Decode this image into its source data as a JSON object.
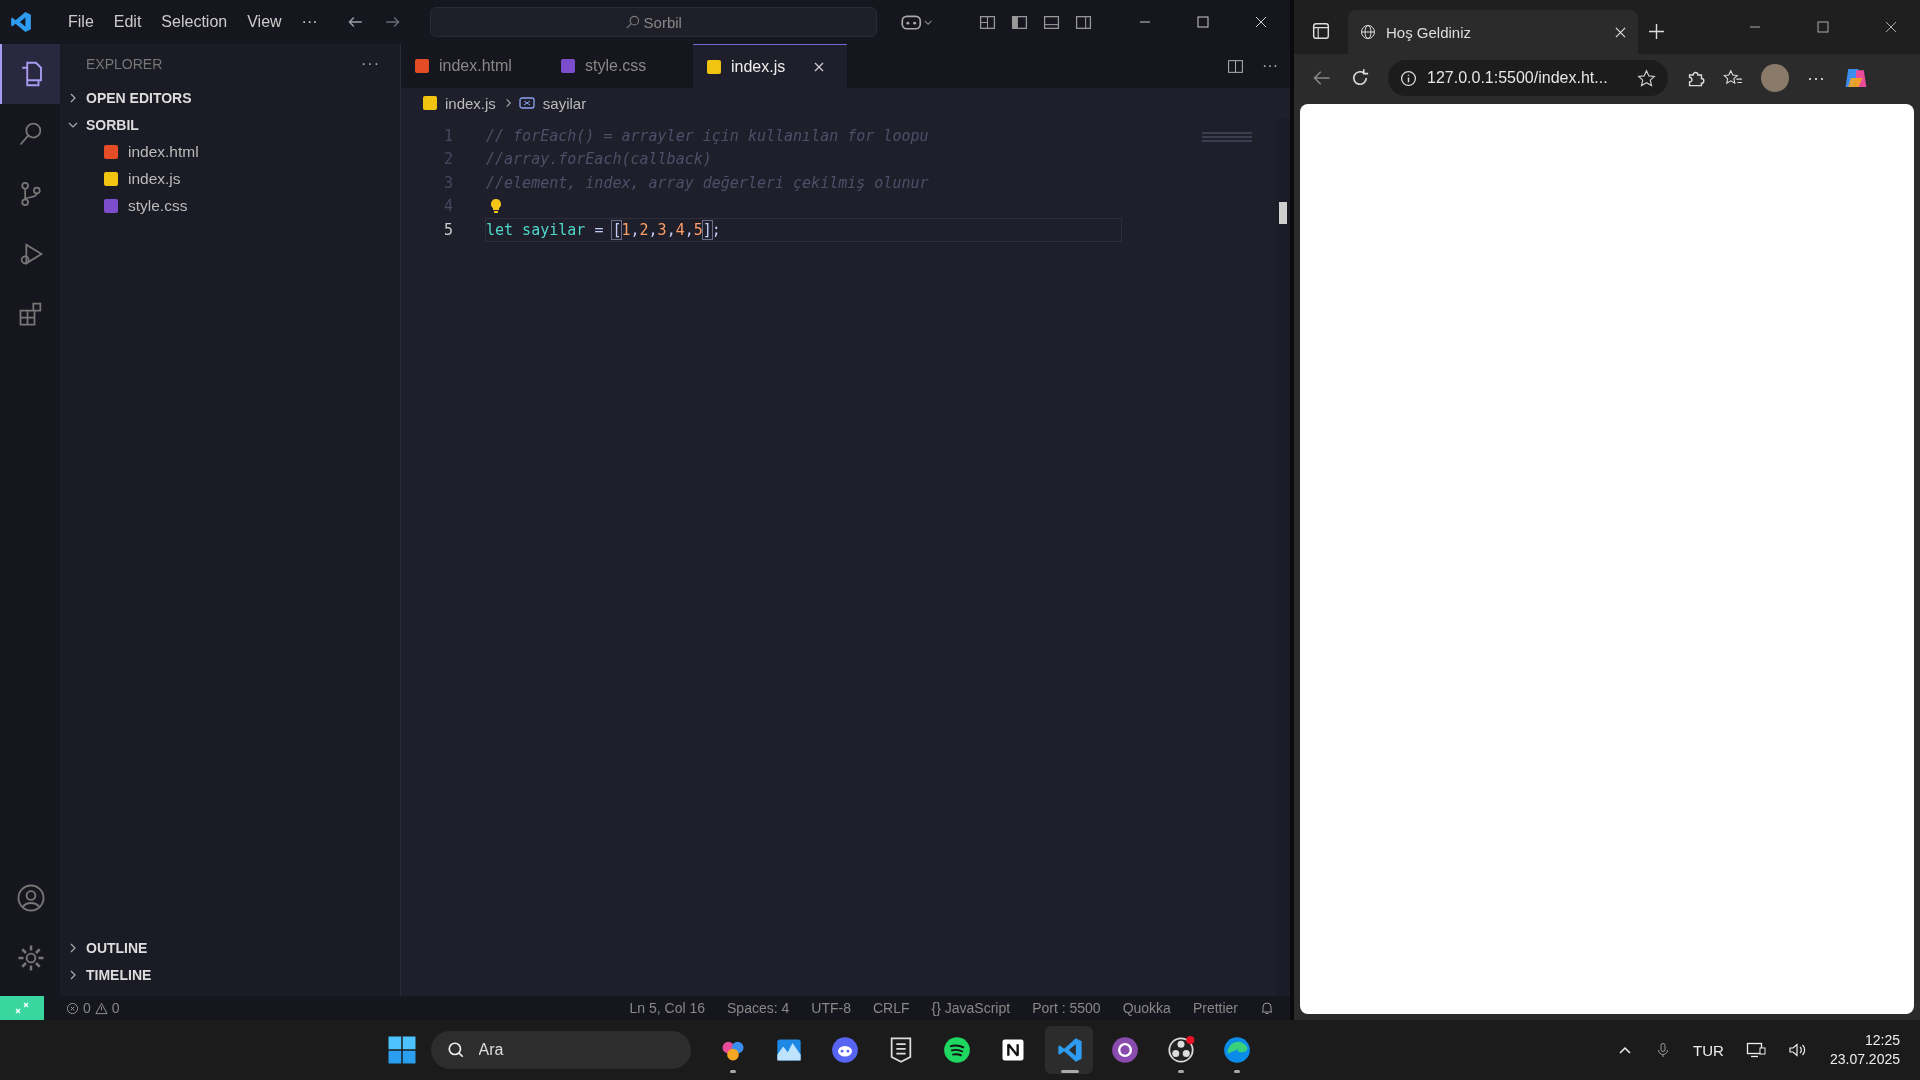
{
  "vscode": {
    "menu": [
      "File",
      "Edit",
      "Selection",
      "View",
      "···"
    ],
    "search": {
      "value": "Sorbil"
    },
    "explorer": {
      "title": "EXPLORER",
      "more": "···",
      "sections": [
        {
          "label": "OPEN EDITORS",
          "expanded": false
        },
        {
          "label": "SORBIL",
          "expanded": true,
          "files": [
            {
              "name": "index.html",
              "kind": "html"
            },
            {
              "name": "index.js",
              "kind": "js"
            },
            {
              "name": "style.css",
              "kind": "css"
            }
          ]
        }
      ],
      "bottom_sections": [
        {
          "label": "OUTLINE",
          "expanded": false
        },
        {
          "label": "TIMELINE",
          "expanded": false
        }
      ]
    },
    "tabs": [
      {
        "label": "index.html",
        "kind": "html",
        "selected": false
      },
      {
        "label": "style.css",
        "kind": "css",
        "selected": false
      },
      {
        "label": "index.js",
        "kind": "js",
        "selected": true
      }
    ],
    "breadcrumb": {
      "file": "index.js",
      "symbol": "sayilar"
    },
    "lines": [
      {
        "number": "1",
        "current": false,
        "hint": false,
        "tokens": [
          {
            "text": "// forEach() = arrayler için kullanılan for loopu",
            "kind": "comment"
          }
        ]
      },
      {
        "number": "2",
        "current": false,
        "hint": false,
        "tokens": [
          {
            "text": "//array.forEach(callback)",
            "kind": "comment"
          }
        ]
      },
      {
        "number": "3",
        "current": false,
        "hint": false,
        "tokens": [
          {
            "text": "//element, index, array değerleri çekilmiş olunur",
            "kind": "comment"
          }
        ]
      },
      {
        "number": "4",
        "current": false,
        "hint": true
      },
      {
        "number": "5",
        "current": true,
        "hint": false,
        "tokens": [
          {
            "text": "let",
            "kind": "keyword"
          },
          {
            "text": " sayilar ",
            "kind": "variable"
          },
          {
            "text": "= ",
            "kind": "operator"
          },
          {
            "text": "[",
            "kind": "bracket-match"
          },
          {
            "text": "1",
            "kind": "number"
          },
          {
            "text": ",",
            "kind": "operator"
          },
          {
            "text": "2",
            "kind": "number"
          },
          {
            "text": ",",
            "kind": "operator"
          },
          {
            "text": "3",
            "kind": "number"
          },
          {
            "text": ",",
            "kind": "operator"
          },
          {
            "text": "4",
            "kind": "number"
          },
          {
            "text": ",",
            "kind": "operator"
          },
          {
            "text": "5",
            "kind": "number"
          },
          {
            "text": "]",
            "kind": "bracket-match"
          },
          {
            "text": ";",
            "kind": "operator"
          }
        ]
      }
    ],
    "status": {
      "errors": "0",
      "warnings": "0",
      "right": [
        "Ln 5, Col 16",
        "Spaces: 4",
        "UTF-8",
        "CRLF",
        "{} JavaScript",
        "Port : 5500",
        "Quokka",
        "Prettier"
      ]
    }
  },
  "browser": {
    "tab": {
      "title": "Hoş Geldiniz"
    },
    "url": "127.0.0.1:5500/index.ht..."
  },
  "taskbar": {
    "search": {
      "placeholder": "Ara"
    },
    "apps": [
      {
        "kind": "paint",
        "running": true
      },
      {
        "kind": "chart",
        "running": false
      },
      {
        "kind": "chat",
        "running": false
      },
      {
        "kind": "games",
        "running": false
      },
      {
        "kind": "music",
        "running": false
      },
      {
        "kind": "notes",
        "running": false
      },
      {
        "kind": "editor",
        "running": true
      },
      {
        "kind": "cat",
        "running": false
      },
      {
        "kind": "record",
        "running": true
      },
      {
        "kind": "browser",
        "running": true
      }
    ],
    "language": "TUR",
    "time": "12:25",
    "date": "23.07.2025"
  }
}
